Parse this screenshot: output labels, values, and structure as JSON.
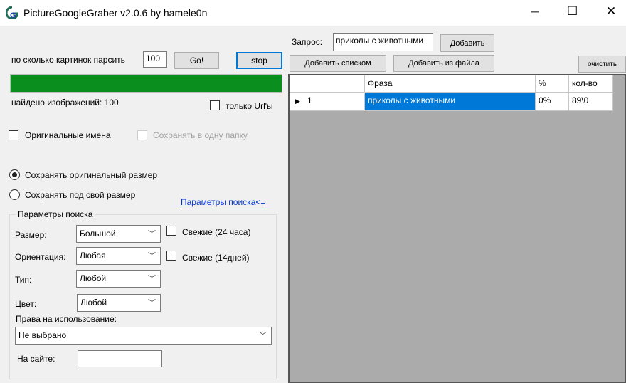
{
  "window": {
    "title": "PictureGoogleGraber v2.0.6 by hamele0n",
    "minimize": "─",
    "maximize": "☐",
    "close": "✕"
  },
  "left": {
    "count_label": "по сколько картинок парсить",
    "count_value": "100",
    "go": "Go!",
    "stop": "stop",
    "progress": 1.0,
    "progress_color": "#0a8f1e",
    "found_label": "найдено изображений: 100",
    "only_urls": "только Url'ы",
    "original_names": "Оригинальные имена",
    "save_one_folder": "Сохранять в одну папку",
    "radio_original": "Сохранять оригинальный размер",
    "radio_custom": "Сохранять под свой размер",
    "search_params_link": "Параметры поиска<="
  },
  "search": {
    "legend": "Параметры поиска",
    "size_label": "Размер:",
    "size_value": "Большой",
    "orient_label": "Ориентация:",
    "orient_value": "Любая",
    "type_label": "Тип:",
    "type_value": "Любой",
    "color_label": "Цвет:",
    "color_value": "Любой",
    "fresh24": "Свежие (24 часа)",
    "fresh14": "Свежие (14дней)",
    "rights_label": "Права на использование:",
    "rights_value": "Не выбрано",
    "site_label": "На сайте:",
    "site_value": ""
  },
  "right": {
    "query_label": "Запрос:",
    "query_value": "приколы с животными",
    "add": "Добавить",
    "add_list": "Добавить списком",
    "add_file": "Добавить из файла",
    "clear": "очистить",
    "columns": [
      "Фраза",
      "%",
      "кол-во"
    ],
    "rows": [
      {
        "num": "1",
        "phrase": "приколы с животными",
        "pct": "0%",
        "count": "89\\0"
      }
    ]
  }
}
